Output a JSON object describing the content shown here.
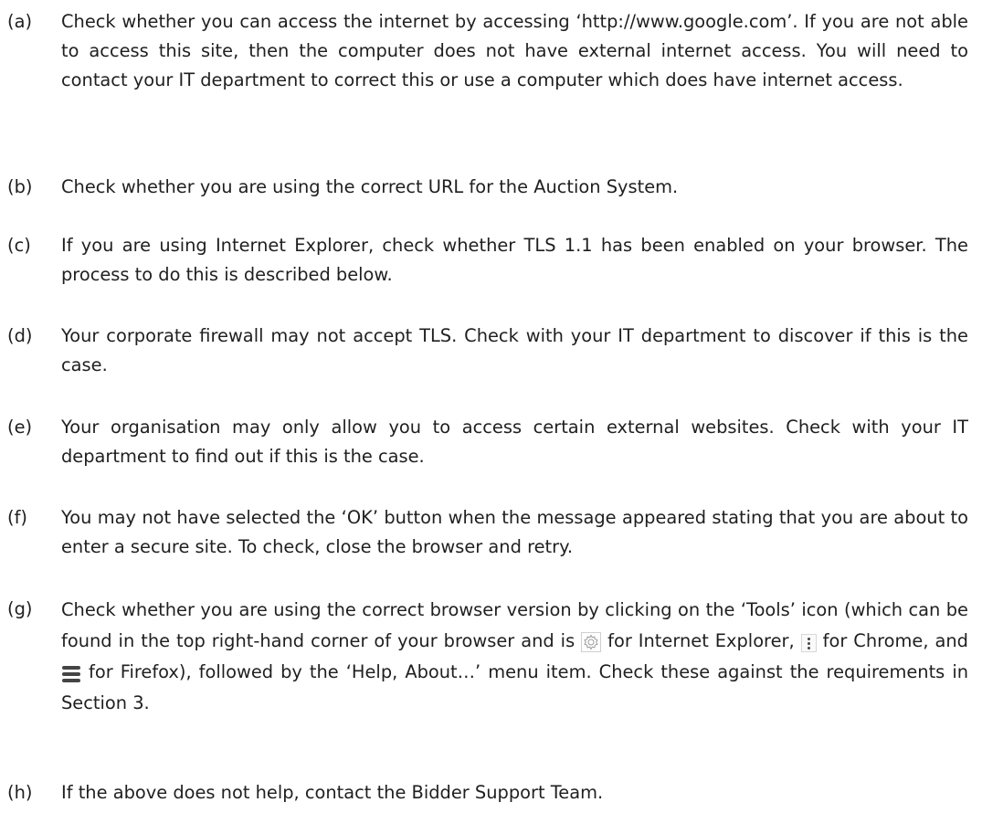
{
  "items": [
    {
      "label": "(a)",
      "text": "Check whether you can access the internet by accessing ‘http://www.google.com’. If you are not able to access this site, then the computer does not have external internet access. You will need to contact your IT department to correct this or use a computer which does have internet access."
    },
    {
      "label": "(b)",
      "text": "Check whether you are using the correct URL for the Auction System."
    },
    {
      "label": "(c)",
      "text": "If you are using Internet Explorer, check whether TLS 1.1 has been enabled on your browser. The process to do this is described below."
    },
    {
      "label": "(d)",
      "text": "Your corporate firewall may not accept TLS. Check with your IT department to discover if this is the case."
    },
    {
      "label": "(e)",
      "text": "Your organisation may only allow you to access certain external websites. Check with your IT department to find out if this is the case."
    },
    {
      "label": "(f)",
      "text": "You may not have selected the ‘OK’ button when the message appeared stating that you are about to enter a secure site. To check, close the browser and retry."
    },
    {
      "label": "(g)",
      "part1": "Check whether you are using the correct browser version by clicking on the ‘Tools’ icon (which can be found in the top right-hand corner of your browser and is",
      "part2": "for Internet Explorer,",
      "part3": "for Chrome, and",
      "part4": "for Firefox), followed by the ‘Help, About…’ menu item. Check these against the requirements in Section 3.",
      "icons": [
        "gear-icon",
        "kebab-menu-icon",
        "hamburger-menu-icon"
      ]
    },
    {
      "label": "(h)",
      "text": "If the above does not help, contact the Bidder Support Team."
    }
  ]
}
